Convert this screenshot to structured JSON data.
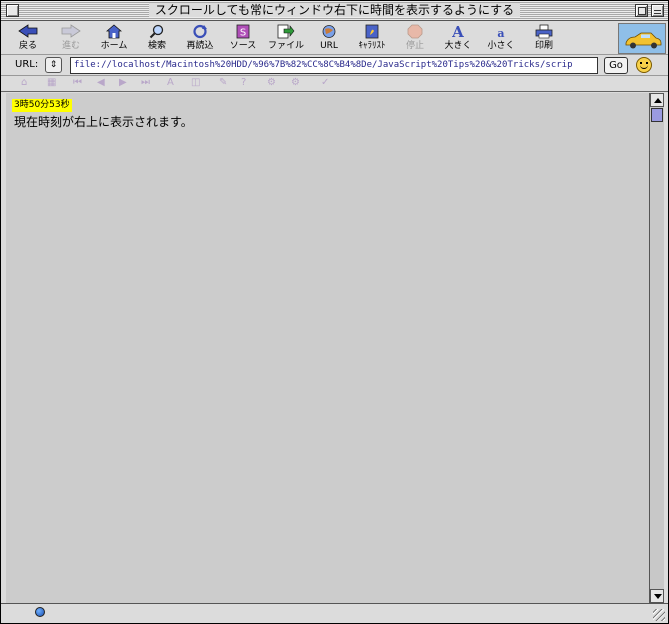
{
  "window": {
    "title": "スクロールしても常にウィンドウ右下に時間を表示するようにする"
  },
  "toolbar": {
    "buttons": [
      {
        "label": "戻る",
        "icon": "back-arrow-icon",
        "enabled": true
      },
      {
        "label": "進む",
        "icon": "forward-arrow-icon",
        "enabled": false
      },
      {
        "label": "ホーム",
        "icon": "home-icon",
        "enabled": true
      },
      {
        "label": "検索",
        "icon": "search-icon",
        "enabled": true
      },
      {
        "label": "再読込",
        "icon": "reload-icon",
        "enabled": true
      },
      {
        "label": "ソース",
        "icon": "source-icon",
        "enabled": true
      },
      {
        "label": "ファイル",
        "icon": "file-icon",
        "enabled": true
      },
      {
        "label": "URL",
        "icon": "globe-icon",
        "enabled": true
      },
      {
        "label": "ｷｬﾗﾘｽﾄ",
        "icon": "character-list-icon",
        "enabled": true
      },
      {
        "label": "停止",
        "icon": "stop-icon",
        "enabled": false
      },
      {
        "label": "大きく",
        "icon": "text-larger-icon",
        "enabled": true
      },
      {
        "label": "小さく",
        "icon": "text-smaller-icon",
        "enabled": true
      },
      {
        "label": "印刷",
        "icon": "print-icon",
        "enabled": true
      }
    ]
  },
  "urlbar": {
    "label": "URL:",
    "stepper": "⇕",
    "value": "file://localhost/Macintosh%20HDD/%96%7B%82%CC%8C%B4%8De/JavaScript%20Tips%20&%20Tricks/scrip",
    "go_label": "Go"
  },
  "content": {
    "clock": "3時50分53秒",
    "message": "現在時刻が右上に表示されます。"
  }
}
